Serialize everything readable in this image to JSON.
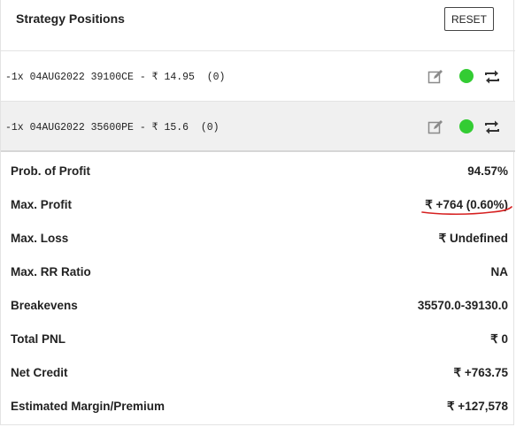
{
  "header": {
    "title": "Strategy Positions",
    "reset_label": "RESET"
  },
  "positions": [
    {
      "label": "-1x 04AUG2022 39100CE - ₹ 14.95  (0)",
      "status_color": "#33cc33"
    },
    {
      "label": "-1x 04AUG2022 35600PE - ₹ 15.6  (0)",
      "status_color": "#33cc33"
    }
  ],
  "stats": [
    {
      "label": "Prob. of Profit",
      "value": "94.57%"
    },
    {
      "label": "Max. Profit",
      "value": "₹ +764 (0.60%)"
    },
    {
      "label": "Max. Loss",
      "value": "₹ Undefined"
    },
    {
      "label": "Max. RR Ratio",
      "value": "NA"
    },
    {
      "label": "Breakevens",
      "value": "35570.0-39130.0"
    },
    {
      "label": "Total PNL",
      "value": "₹ 0"
    },
    {
      "label": "Net Credit",
      "value": "₹ +763.75"
    },
    {
      "label": "Estimated Margin/Premium",
      "value": "₹ +127,578"
    }
  ],
  "icons": {
    "edit": "edit-icon",
    "status": "status-dot-icon",
    "swap": "swap-arrows-icon"
  },
  "colors": {
    "status_green": "#33cc33",
    "annotation_red": "#d62020",
    "border": "#e3e3e3"
  }
}
